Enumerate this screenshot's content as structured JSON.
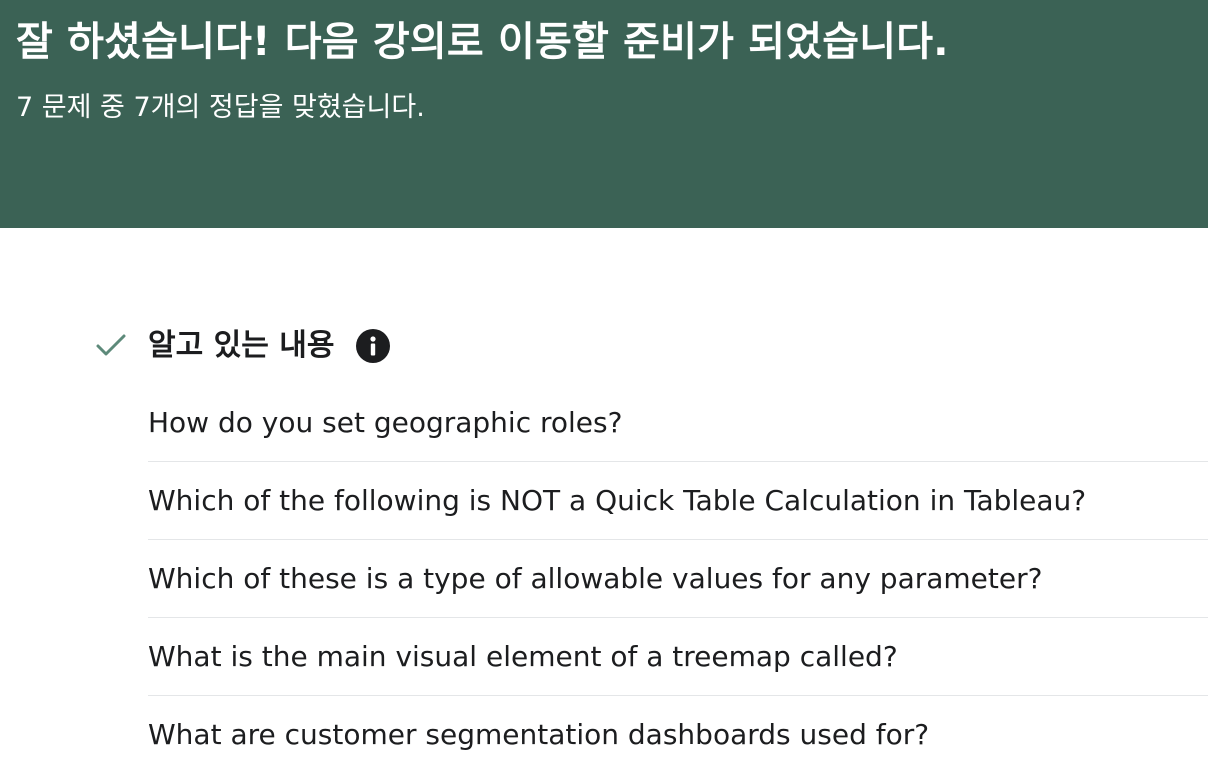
{
  "banner": {
    "title": "잘 하셨습니다! 다음 강의로 이동할 준비가 되었습니다.",
    "subtitle": "7 문제 중 7개의 정답을 맞혔습니다."
  },
  "section": {
    "status_icon": "check-icon",
    "title": "알고 있는 내용",
    "info_icon": "info-icon",
    "questions": [
      "How do you set geographic roles?",
      "Which of the following is NOT a Quick Table Calculation in Tableau?",
      "Which of these is a type of allowable values for any parameter?",
      "What is the main visual element of a treemap called?",
      "What are customer segmentation dashboards used for?"
    ]
  },
  "colors": {
    "banner_bg": "#3b6255",
    "check": "#5d8a7a",
    "divider": "#e4e6e8"
  }
}
